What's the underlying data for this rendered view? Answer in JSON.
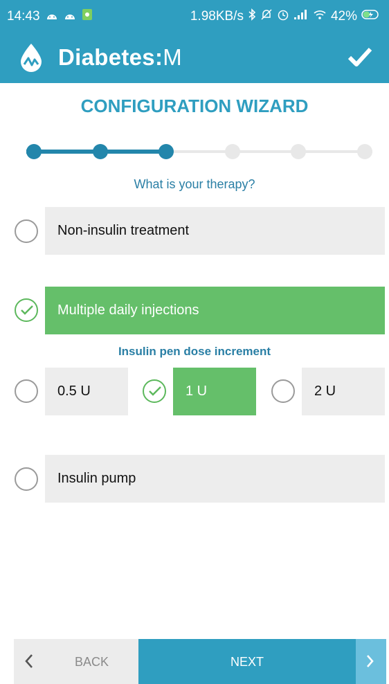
{
  "status_bar": {
    "time": "14:43",
    "net_speed": "1.98KB/s",
    "battery": "42%"
  },
  "app_bar": {
    "title_bold": "Diabetes:",
    "title_light": "M"
  },
  "wizard": {
    "title": "CONFIGURATION WIZARD",
    "progress": {
      "current_step": 3,
      "total_steps": 6
    },
    "question": "What is your therapy?"
  },
  "options": {
    "non_insulin": {
      "label": "Non-insulin treatment",
      "selected": false
    },
    "mdi": {
      "label": "Multiple daily injections",
      "selected": true
    },
    "pump": {
      "label": "Insulin pump",
      "selected": false
    }
  },
  "pen_increment": {
    "title": "Insulin pen dose increment",
    "choices": [
      {
        "label": "0.5 U",
        "selected": false
      },
      {
        "label": "1 U",
        "selected": true
      },
      {
        "label": "2 U",
        "selected": false
      }
    ]
  },
  "nav": {
    "back_label": "BACK",
    "next_label": "NEXT"
  },
  "colors": {
    "primary": "#2f9ec0",
    "selected": "#65bf6a",
    "option_bg": "#ededed"
  }
}
